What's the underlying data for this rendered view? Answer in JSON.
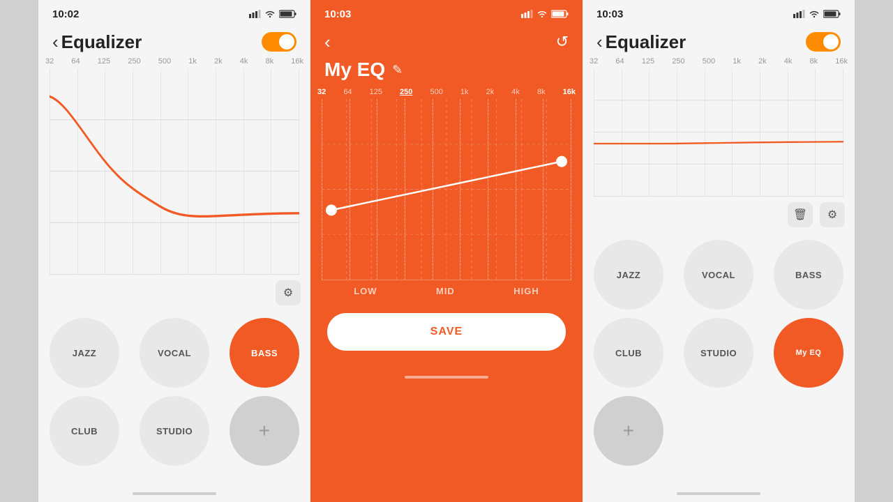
{
  "screens": [
    {
      "id": "screen-left",
      "theme": "light",
      "status": {
        "time": "10:02",
        "signal": "▎▎▎",
        "wifi": "wifi",
        "battery": "battery"
      },
      "nav": {
        "back_label": "‹",
        "title": "Equalizer",
        "has_toggle": true
      },
      "freq_labels": [
        "32",
        "64",
        "125",
        "250",
        "500",
        "1k",
        "2k",
        "4k",
        "8k",
        "16k"
      ],
      "active_freq": null,
      "curve_type": "bass_boost",
      "presets_row1": [
        {
          "label": "JAZZ",
          "active": false
        },
        {
          "label": "VOCAL",
          "active": false
        },
        {
          "label": "BASS",
          "active": true
        }
      ],
      "presets_row2": [
        {
          "label": "CLUB",
          "active": false
        },
        {
          "label": "STUDIO",
          "active": false
        },
        {
          "label": "+",
          "is_add": true
        }
      ]
    },
    {
      "id": "screen-middle",
      "theme": "orange",
      "status": {
        "time": "10:03",
        "signal": "▎▎▎",
        "wifi": "wifi",
        "battery": "battery"
      },
      "nav": {
        "back_label": "‹",
        "title": "My EQ",
        "has_reset": true
      },
      "freq_labels": [
        "32",
        "64",
        "125",
        "250",
        "500",
        "1k",
        "2k",
        "4k",
        "8k",
        "16k"
      ],
      "active_freq": "250",
      "active_freq_right": "16k",
      "curve_type": "linear_rise",
      "band_labels": [
        "LOW",
        "MID",
        "HIGH"
      ],
      "save_label": "SAVE"
    },
    {
      "id": "screen-right",
      "theme": "light",
      "status": {
        "time": "10:03",
        "signal": "▎▎▎",
        "wifi": "wifi",
        "battery": "battery"
      },
      "nav": {
        "back_label": "‹",
        "title": "Equalizer",
        "has_toggle": true
      },
      "freq_labels": [
        "32",
        "64",
        "125",
        "250",
        "500",
        "1k",
        "2k",
        "4k",
        "8k",
        "16k"
      ],
      "active_freq": null,
      "curve_type": "flat_high",
      "presets_row1": [
        {
          "label": "JAZZ",
          "active": false
        },
        {
          "label": "VOCAL",
          "active": false
        },
        {
          "label": "BASS",
          "active": false
        }
      ],
      "presets_row2": [
        {
          "label": "CLUB",
          "active": false
        },
        {
          "label": "STUDIO",
          "active": false
        },
        {
          "label": "My EQ",
          "active": true
        }
      ],
      "presets_row3": [
        {
          "label": "+",
          "is_add": true
        }
      ]
    }
  ],
  "icons": {
    "back": "‹",
    "reset": "↺",
    "edit": "✎",
    "settings": "⚙",
    "delete": "🗑",
    "add": "+"
  }
}
